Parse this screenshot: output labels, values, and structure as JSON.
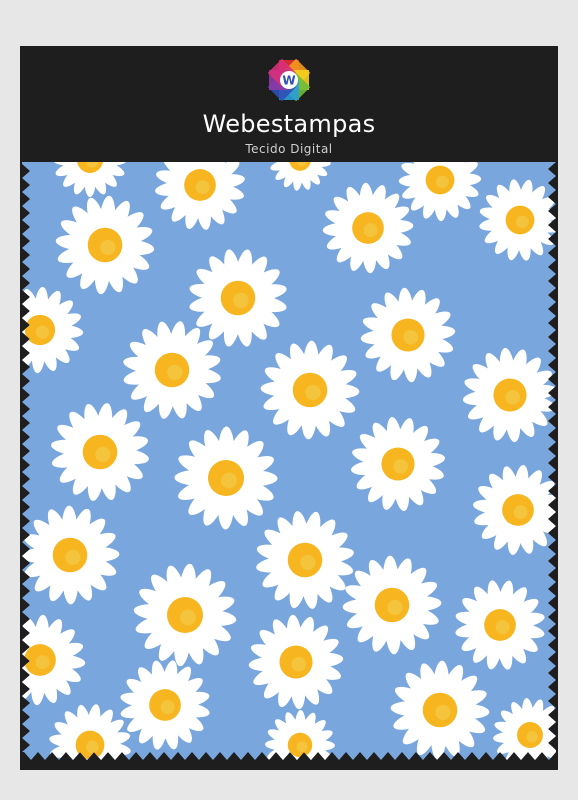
{
  "brand": {
    "name": "Webestampas",
    "subtitle": "Tecido Digital",
    "logo_letter": "W",
    "logo_colors": [
      "#e62e2e",
      "#f39a1c",
      "#f4d21e",
      "#6bbd3a",
      "#2a9fd8",
      "#2f4fb5",
      "#8e3aa6",
      "#d8307a"
    ]
  },
  "swatch": {
    "header_color": "#1e1e1e",
    "fabric_color": "#7aa6de",
    "petal_color": "#ffffff",
    "center_color": "#f7b51f"
  },
  "page": {
    "background": "#e7e7e7"
  }
}
